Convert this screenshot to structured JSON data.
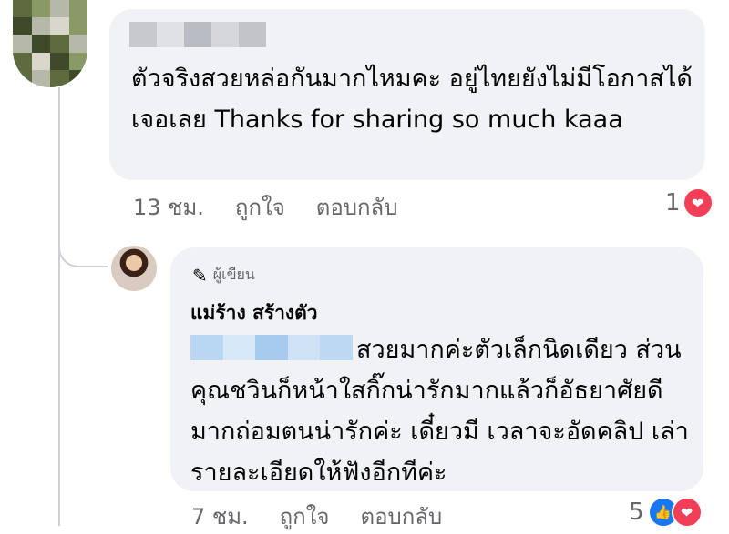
{
  "comment1": {
    "text": "ตัวจริงสวยหล่อกันมากไหมคะ อยู่ไทยยังไม่มีโอกาสได้เจอเลย Thanks for sharing so much kaaa",
    "time": "13 ชม.",
    "like_label": "ถูกใจ",
    "reply_label": "ตอบกลับ",
    "reaction_count": "1",
    "reactions": [
      "heart-icon"
    ]
  },
  "reply": {
    "badge": "ผู้เขียน",
    "author": "แม่ร้าง สร้างตัว",
    "text": "สวยมากค่ะตัวเล็กนิดเดียว ส่วนคุณชวินก็หน้าใสกิ๊กน่ารักมากแล้วก็อัธยาศัยดีมากถ่อมตนน่ารักค่ะ เดี๋ยวมี เวลาจะอัดคลิป เล่ารายละเอียดให้ฟังอีกทีค่ะ",
    "time": "7 ชม.",
    "like_label": "ถูกใจ",
    "reply_label": "ตอบกลับ",
    "reaction_count": "5",
    "reactions": [
      "like-icon",
      "heart-icon"
    ]
  },
  "colors": {
    "bubble": "#f0f2f5",
    "meta": "#65676b",
    "like": "#1877f2",
    "heart": "#f33e58"
  }
}
